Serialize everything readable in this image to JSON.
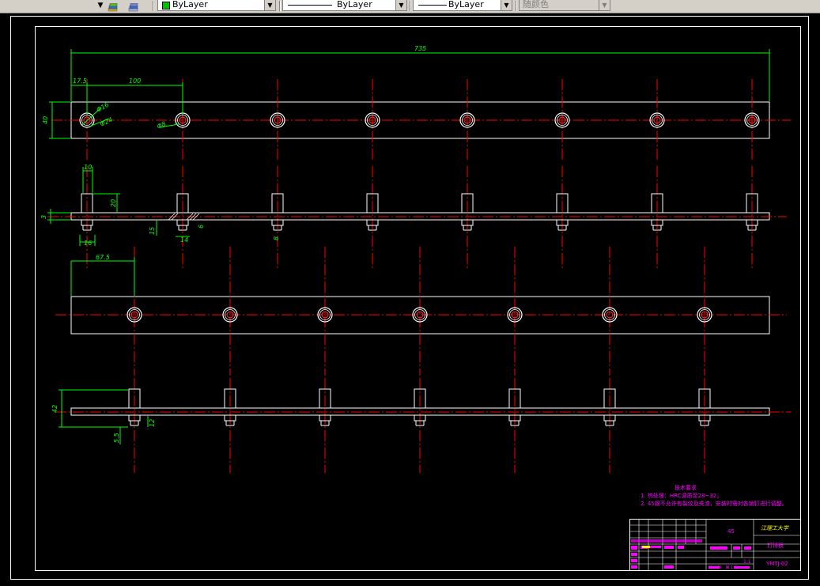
{
  "toolbar": {
    "layer_color": "ByLayer",
    "linetype": "ByLayer",
    "lineweight": "ByLayer",
    "plot_style": "随颜色"
  },
  "drawing": {
    "dims": {
      "overall_length": "735",
      "edge_offset": "17.5",
      "pitch": "100",
      "height_top": "40",
      "hole_d1": "Φ16",
      "hole_d2": "Φ24",
      "hole_d3": "Φ8",
      "pin_w": "10",
      "pin_h": "20",
      "plate_t": "3",
      "h15": "15",
      "w16": "16",
      "w14": "14",
      "w6": "6",
      "d8": "8",
      "offset_67": "67.5",
      "h42": "42",
      "h55": "5.5",
      "h12": "12"
    },
    "notes": {
      "title": "技术要求",
      "line1": "1. 热处理：HRC调质至28~32；",
      "line2": "2. 45钢不允许有裂纹及夹渣，安装时需对各销钉进行调整。"
    },
    "title_block": {
      "school": "江理工大学",
      "material": "45",
      "part_name": "钉排板",
      "drawing_no": "YMTJ-02",
      "scale": "1:1",
      "sheet": "共 1 张　第 1 张"
    }
  },
  "colors": {
    "toolbar_bg": "#d4d0c8",
    "centerline": "#ff0000",
    "dimension": "#00ff00",
    "notes": "#ff00ff",
    "geometry": "#ffffff",
    "title_block_text": "#ffff00"
  }
}
